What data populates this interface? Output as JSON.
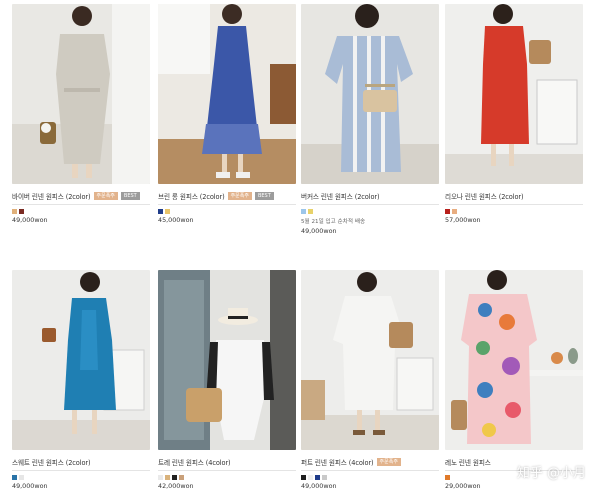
{
  "products": [
    {
      "name": "바이버 린넨 원피스 (2color)",
      "badges": [
        {
          "text": "주문폭주",
          "type": "new"
        },
        {
          "text": "BEST",
          "type": "best"
        }
      ],
      "swatches": [
        "#e0b07a",
        "#7a2a22"
      ],
      "note": "",
      "price": "49,000won"
    },
    {
      "name": "브린 롱 원피스 (2color)",
      "badges": [
        {
          "text": "주문폭주",
          "type": "new"
        },
        {
          "text": "BEST",
          "type": "best"
        }
      ],
      "swatches": [
        "#1f3c8a",
        "#e8c46a"
      ],
      "note": "",
      "price": "45,000won"
    },
    {
      "name": "버커스 린넨 원피스 (2color)",
      "badges": [],
      "swatches": [
        "#9cc6ea",
        "#e8d26a"
      ],
      "note": "5월 21일 입고 순차적 배송",
      "price": "49,000won"
    },
    {
      "name": "리오나 린넨 원피스 (2color)",
      "badges": [],
      "swatches": [
        "#b8201c",
        "#e8ad80"
      ],
      "note": "",
      "price": "57,000won"
    },
    {
      "name": "스웨트 린넨 원피스 (2color)",
      "badges": [],
      "swatches": [
        "#2a74a8",
        "#e6e6e6"
      ],
      "note": "",
      "price": "49,000won"
    },
    {
      "name": "트레 린넨 원피스 (4color)",
      "badges": [],
      "swatches": [
        "#eaeaea",
        "#d9b27c",
        "#222222",
        "#c9a07a"
      ],
      "note": "",
      "price": "42,000won"
    },
    {
      "name": "퍼트 린넨 원피스 (4color)",
      "badges": [
        {
          "text": "주문폭주",
          "type": "new"
        }
      ],
      "swatches": [
        "#1f1f1f",
        "#f0f0f0",
        "#1f3c8a",
        "#c9c9c9"
      ],
      "note": "",
      "price": "49,000won"
    },
    {
      "name": "레노 린넨 원피스",
      "badges": [],
      "swatches": [
        "#e07a2a"
      ],
      "note": "",
      "price": "29,000won"
    }
  ],
  "watermark": "知乎 @小月"
}
